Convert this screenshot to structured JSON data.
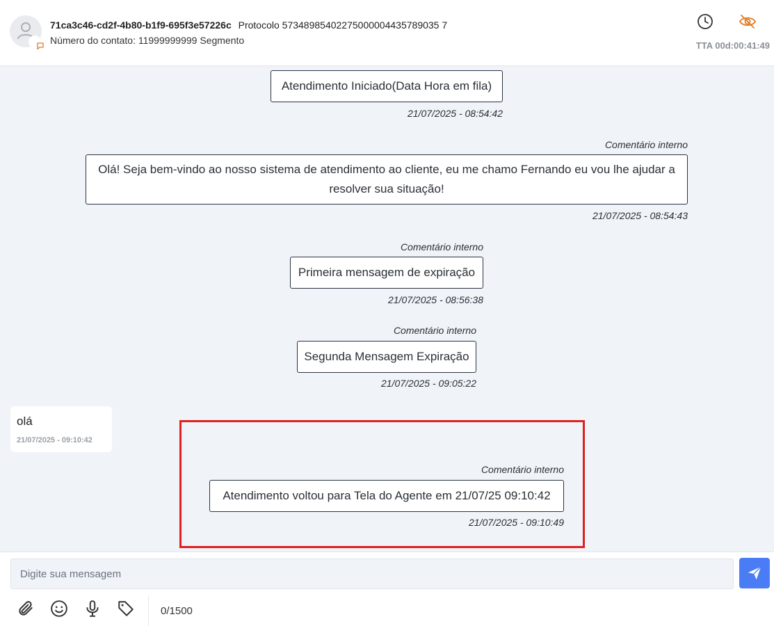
{
  "header": {
    "contact_id": "71ca3c46-cd2f-4b80-b1f9-695f3e57226c",
    "protocol": "Protocolo 57348985402275000004435789035 7",
    "contact_line": "Número do contato: 11999999999 Segmento",
    "tta": "TTA 00d:00:41:49",
    "icons": [
      "clock-icon",
      "eye-off-icon"
    ],
    "accent_color": "#e07b22"
  },
  "messages": [
    {
      "type": "system",
      "text": "Atendimento Iniciado(Data Hora em fila)",
      "timestamp": "21/07/2025 - 08:54:42"
    },
    {
      "type": "internal",
      "label": "Comentário interno",
      "text": "Olá! Seja bem-vindo ao nosso sistema de atendimento ao cliente, eu me chamo Fernando eu vou lhe ajudar a resolver sua situação!",
      "timestamp": "21/07/2025 - 08:54:43"
    },
    {
      "type": "internal",
      "label": "Comentário interno",
      "text": "Primeira mensagem de expiração",
      "timestamp": "21/07/2025 - 08:56:38"
    },
    {
      "type": "internal",
      "label": "Comentário interno",
      "text": "Segunda Mensagem Expiração",
      "timestamp": "21/07/2025 - 09:05:22"
    },
    {
      "type": "client",
      "text": "olá",
      "timestamp": "21/07/2025 - 09:10:42"
    },
    {
      "type": "internal",
      "label": "Comentário interno",
      "text": "Atendimento voltou para Tela do Agente em 21/07/25 09:10:42",
      "timestamp": "21/07/2025 - 09:10:49"
    }
  ],
  "composer": {
    "placeholder": "Digite sua mensagem",
    "value": "",
    "counter": "0/1500",
    "send_color": "#4a7cf6",
    "tools": [
      "paperclip-icon",
      "emoji-icon",
      "microphone-icon",
      "tag-icon"
    ]
  },
  "highlight_color": "#e02020"
}
